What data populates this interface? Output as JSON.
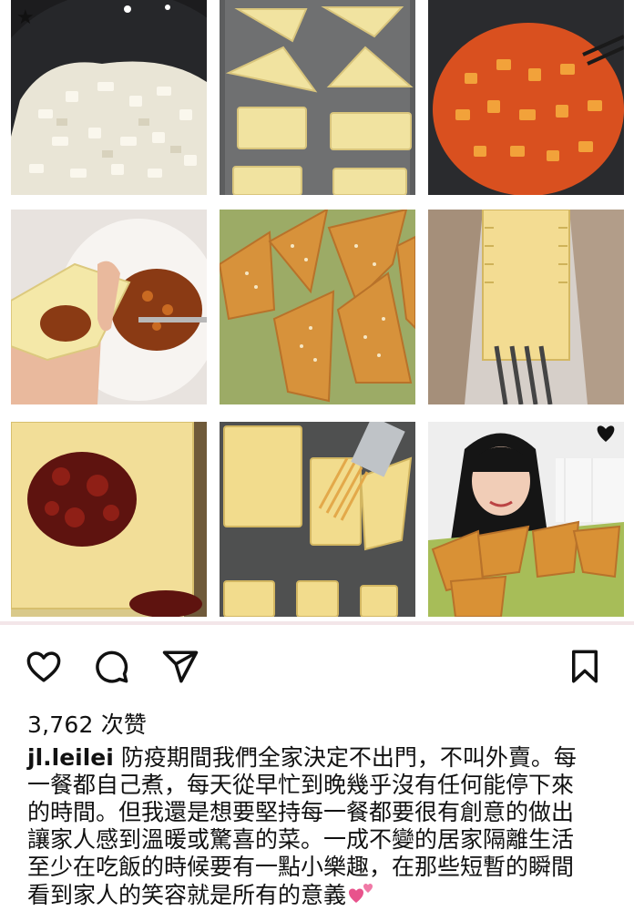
{
  "post": {
    "likes_label": "3,762 次赞",
    "username": "jl.leilei",
    "caption_lines": [
      "防疫期間我們全家決定不出門，不叫外賣。每",
      "一餐都自己煮，每天從早忙到晚幾乎沒有任何能停下來",
      "的時間。但我還是想要堅持每一餐都要很有創意的做出",
      "讓家人感到溫暖或驚喜的菜。一成不變的居家隔離生活",
      "至少在吃飯的時候要有一點小樂趣，在那些短暫的瞬間",
      "看到家人的笑容就是所有的意義"
    ],
    "caption_emoji": "two-hearts-icon"
  },
  "actions": {
    "like": "heart-icon",
    "comment": "comment-bubble-icon",
    "share": "paper-plane-icon",
    "save": "bookmark-icon"
  },
  "photos": [
    "onions-in-wok",
    "folded-pastry-triangles-on-tray",
    "tomato-filling-in-wok",
    "hand-holding-filled-dough",
    "baked-sesame-triangles",
    "fork-crimping-pastry",
    "jam-filling-on-dough",
    "brushing-egg-wash",
    "woman-with-baked-pastries"
  ],
  "colors": {
    "accent_heart": "#e8538c",
    "icon": "#111111"
  }
}
